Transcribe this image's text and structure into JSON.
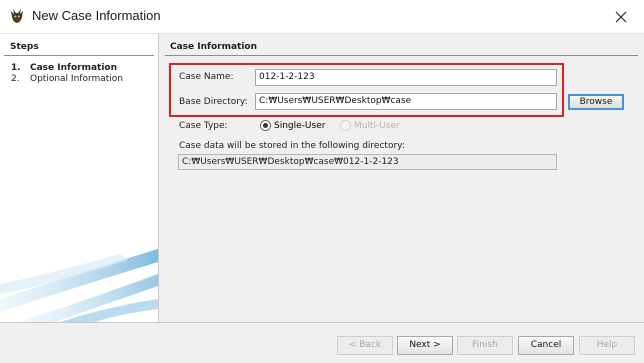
{
  "window": {
    "title": "New Case Information",
    "close_glyph": "✕",
    "icon": "autopsy-dog-icon"
  },
  "steps": {
    "heading": "Steps",
    "items": [
      {
        "number": "1.",
        "label": "Case Information",
        "active": true
      },
      {
        "number": "2.",
        "label": "Optional Information",
        "active": false
      }
    ]
  },
  "case_info": {
    "heading": "Case Information",
    "case_name_label": "Case Name:",
    "case_name_value": "012-1-2-123",
    "base_dir_label": "Base Directory:",
    "base_dir_value": "C:₩Users₩USER₩Desktop₩case",
    "browse_label": "Browse",
    "case_type_label": "Case Type:",
    "case_type_options": [
      {
        "label": "Single-User",
        "selected": true,
        "enabled": true
      },
      {
        "label": "Multi-User",
        "selected": false,
        "enabled": false
      }
    ],
    "storage_note": "Case data will be stored in the following directory:",
    "storage_path": "C:₩Users₩USER₩Desktop₩case₩012-1-2-123"
  },
  "buttons": {
    "back": "< Back",
    "next": "Next >",
    "finish": "Finish",
    "cancel": "Cancel",
    "help": "Help"
  },
  "colors": {
    "highlight_box": "#e02020",
    "focus_border": "#4a90d8"
  }
}
